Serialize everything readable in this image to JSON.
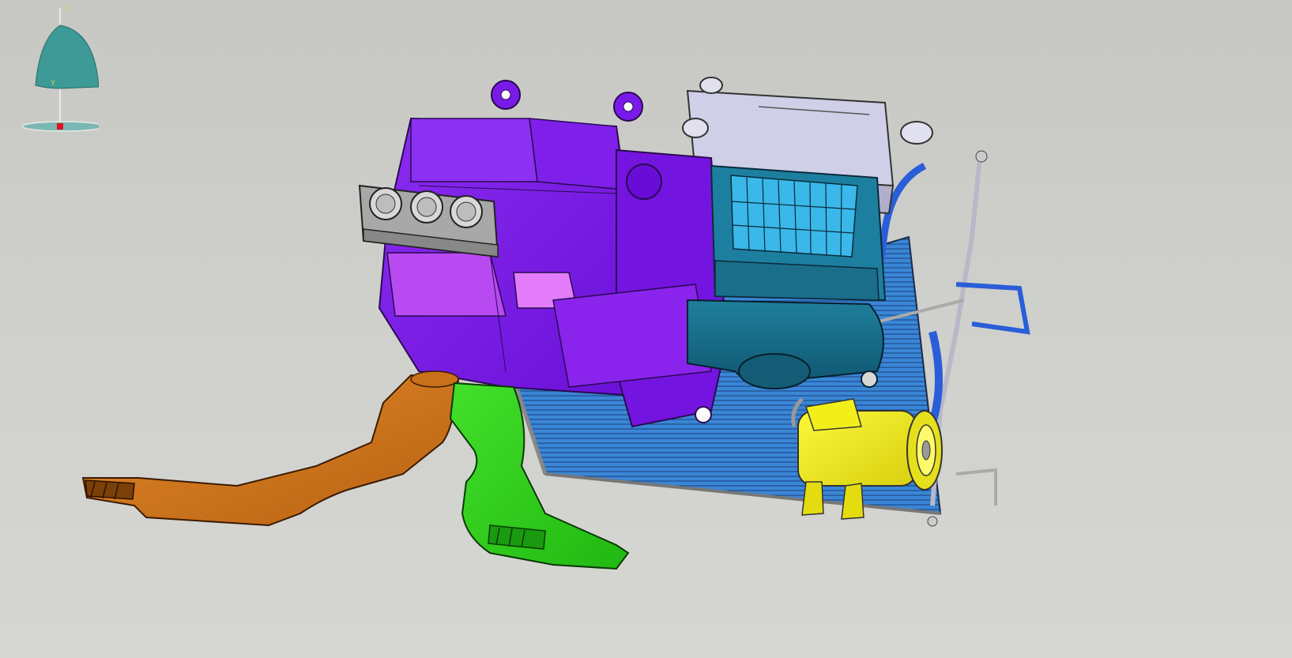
{
  "viewport": {
    "background_top": "#c7c8c4",
    "background_bottom": "#d6d7d3"
  },
  "parts": [
    {
      "id": "defroster-duct-left",
      "color": "#d2781c"
    },
    {
      "id": "floor-duct-right",
      "color": "#2fcf1c"
    },
    {
      "id": "hvac-module",
      "color": "#7a1ae8"
    },
    {
      "id": "hvac-module-light",
      "color": "#c455f2"
    },
    {
      "id": "climate-control-panel",
      "color": "#a8a8a8"
    },
    {
      "id": "blower-housing",
      "color": "#1a6e8a"
    },
    {
      "id": "evaporator-filter",
      "color": "#3ab8ea"
    },
    {
      "id": "air-intake-box",
      "color": "#cfcfe8"
    },
    {
      "id": "condenser",
      "color": "#3a86d6"
    },
    {
      "id": "ac-compressor",
      "color": "#f2ee1a"
    },
    {
      "id": "refrigerant-hoses",
      "color": "#2a5ed8"
    }
  ],
  "compass": {
    "z_label": "Z",
    "y_label": "Y",
    "dome_color": "#3d9a96",
    "origin_color": "#e0101c"
  }
}
